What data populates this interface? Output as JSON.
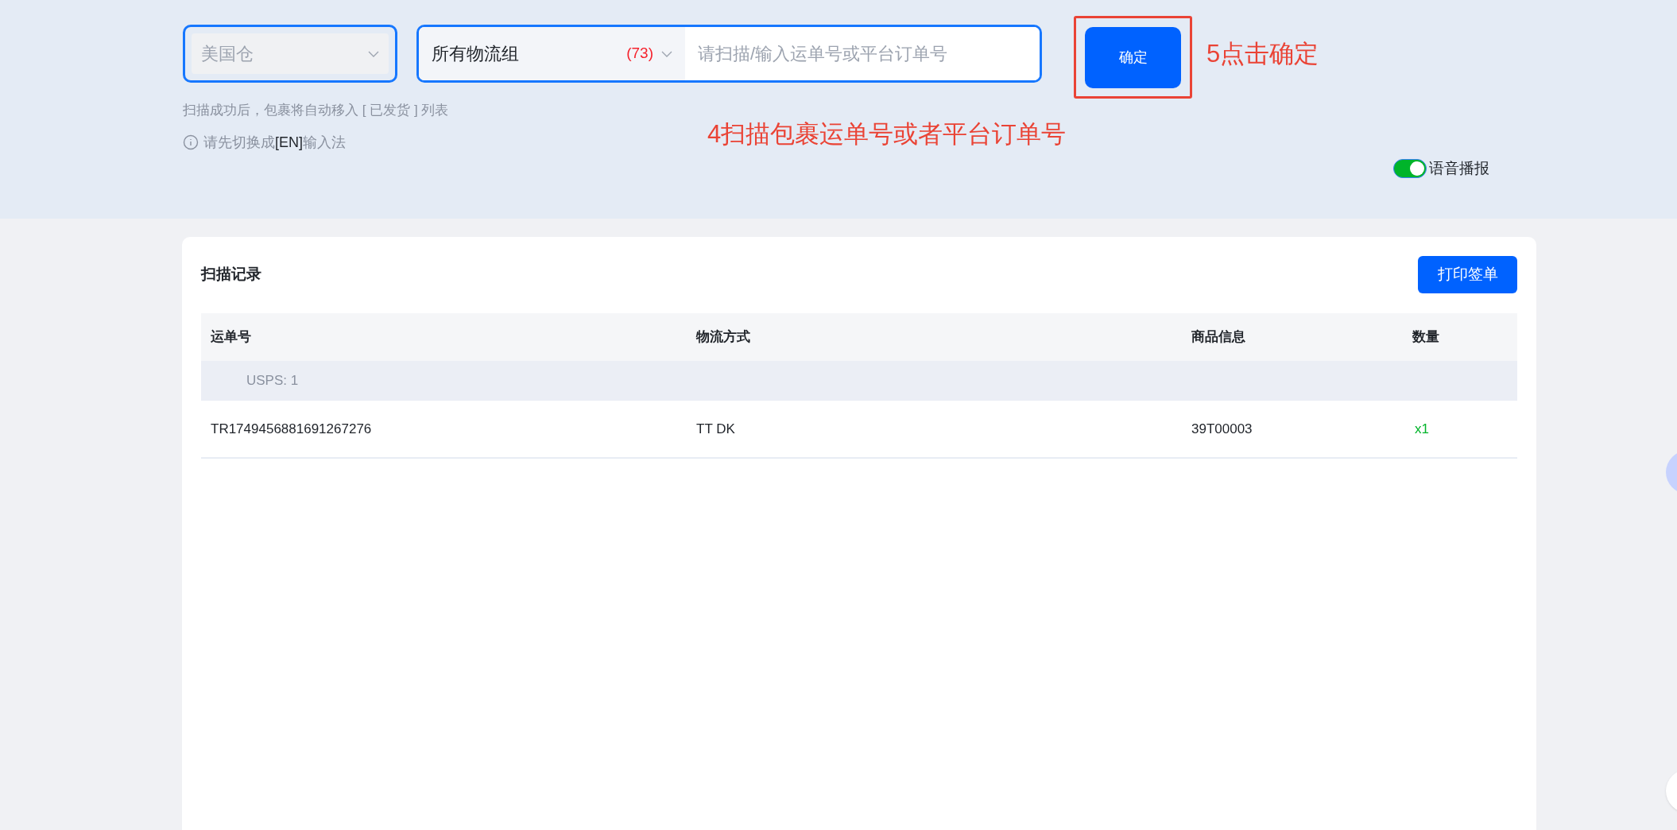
{
  "scan_bar": {
    "warehouse": {
      "value": "美国仓"
    },
    "logistics_group": {
      "value": "所有物流组",
      "count": "(73)"
    },
    "scan_input": {
      "placeholder": "请扫描/输入运单号或平台订单号"
    },
    "confirm_button": "确定",
    "hint": "扫描成功后，包裹将自动移入 [ 已发货 ] 列表",
    "ime_tip": "请先切换成**[EN]**输入法",
    "voice_broadcast": {
      "label": "语音播报",
      "on": true
    }
  },
  "annotations": [
    {
      "kind": "box-note",
      "text": "5点击确定"
    },
    {
      "kind": "note",
      "text": "4扫描包裹运单号或者平台订单号"
    }
  ],
  "scan_records": {
    "title": "扫描记录",
    "print_button": "打印签单",
    "table": {
      "columns": [
        "运单号",
        "物流方式",
        "商品信息",
        "数量"
      ],
      "groups": [
        {
          "label": "USPS: 1",
          "rows": [
            {
              "tracking_number": "TR1749456881691267276",
              "logistics": "TT DK",
              "product": "39T00003",
              "quantity": "x1"
            }
          ]
        }
      ]
    }
  }
}
